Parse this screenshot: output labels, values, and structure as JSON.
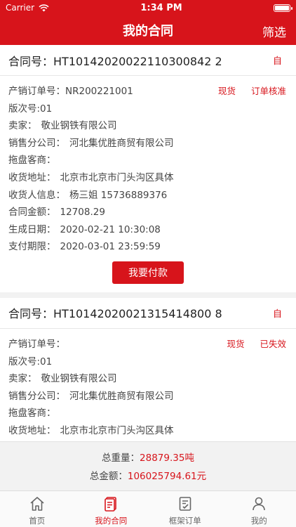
{
  "status_bar": {
    "carrier": "Carrier",
    "time": "1:34 PM"
  },
  "nav": {
    "title": "我的合同",
    "filter": "筛选"
  },
  "contracts": [
    {
      "contract_label": "合同号：",
      "contract_no": "HT10142020022110300842 2",
      "tag": "自",
      "order_label": "产销订单号：",
      "order_no": "NR200221001",
      "badge1": "现货",
      "badge2": "订单核准",
      "version": "版次号:01",
      "seller_label": "卖家：",
      "seller": "敬业钢铁有限公司",
      "branch_label": "销售分公司：",
      "branch": "河北集优胜商贸有限公司",
      "tow_label": "拖盘客商：",
      "tow": "",
      "addr_label": "收货地址：",
      "addr": "北京市北京市门头沟区具体",
      "receiver_label": "收货人信息：",
      "receiver": "杨三姐    15736889376",
      "amount_label": "合同金额：",
      "amount": "12708.29",
      "created_label": "生成日期：",
      "created": "2020-02-21 10:30:08",
      "deadline_label": "支付期限：",
      "deadline": "2020-03-01 23:59:59",
      "pay_button": "我要付款"
    },
    {
      "contract_label": "合同号：",
      "contract_no": "HT10142020021315414800 8",
      "tag": "自",
      "order_label": "产销订单号：",
      "order_no": "",
      "badge1": "现货",
      "badge2": "已失效",
      "version": "版次号:01",
      "seller_label": "卖家：",
      "seller": "敬业钢铁有限公司",
      "branch_label": "销售分公司：",
      "branch": "河北集优胜商贸有限公司",
      "tow_label": "拖盘客商：",
      "tow": "",
      "addr_label": "收货地址：",
      "addr": "北京市北京市门头沟区具体"
    }
  ],
  "summary": {
    "weight_label": "总重量：",
    "weight": "28879.35吨",
    "amount_label": "总金额：",
    "amount": "106025794.61元"
  },
  "tabs": [
    {
      "label": "首页",
      "icon": "home-icon"
    },
    {
      "label": "我的合同",
      "icon": "contract-icon"
    },
    {
      "label": "框架订单",
      "icon": "order-icon"
    },
    {
      "label": "我的",
      "icon": "user-icon"
    }
  ],
  "colors": {
    "brand": "#d7141b",
    "background": "#f2f2f2"
  }
}
